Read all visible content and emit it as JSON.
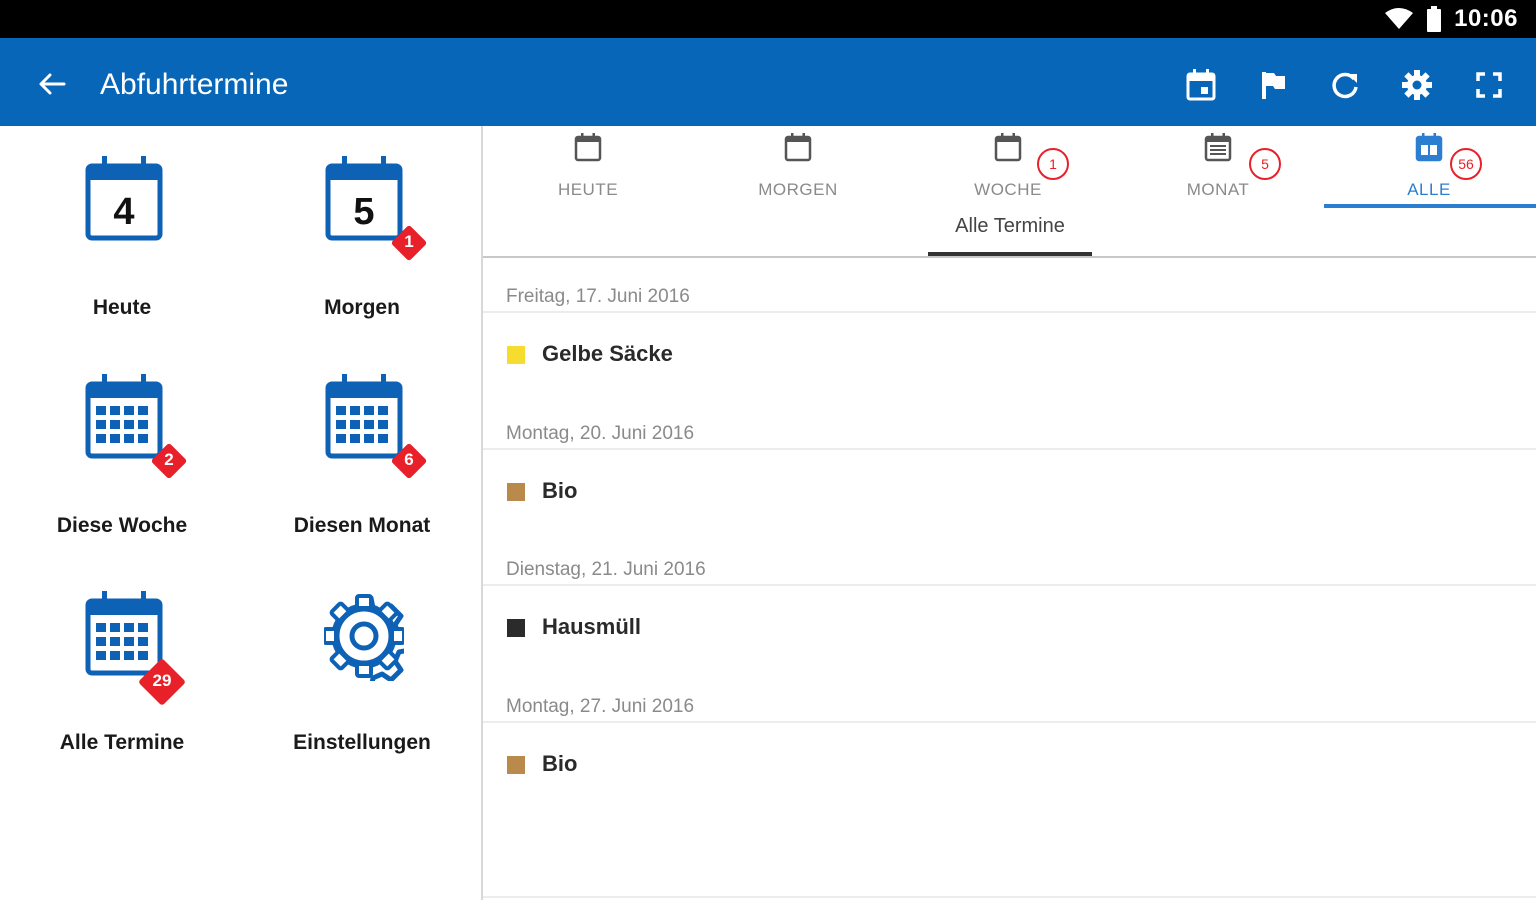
{
  "status_bar": {
    "time": "10:06"
  },
  "app_bar": {
    "title": "Abfuhrtermine",
    "actions": [
      "calendar-today-icon",
      "flag-icon",
      "refresh-icon",
      "settings-icon",
      "fullscreen-icon"
    ]
  },
  "tiles": [
    {
      "label": "Heute",
      "day": "4"
    },
    {
      "label": "Morgen",
      "day": "5",
      "badge": "1"
    },
    {
      "label": "Diese Woche",
      "badge": "2"
    },
    {
      "label": "Diesen Monat",
      "badge": "6"
    },
    {
      "label": "Alle Termine",
      "badge": "29"
    },
    {
      "label": "Einstellungen"
    }
  ],
  "tabs": [
    {
      "label": "HEUTE"
    },
    {
      "label": "MORGEN"
    },
    {
      "label": "WOCHE",
      "count": "1"
    },
    {
      "label": "MONAT",
      "count": "5"
    },
    {
      "label": "ALLE",
      "count": "56",
      "active": true
    }
  ],
  "subtab": "Alle Termine",
  "groups": [
    {
      "date": "Freitag, 17. Juni 2016",
      "item": "Gelbe Säcke",
      "color": "#f5dc2e"
    },
    {
      "date": "Montag, 20. Juni 2016",
      "item": "Bio",
      "color": "#b98a4c"
    },
    {
      "date": "Dienstag, 21. Juni 2016",
      "item": "Hausmüll",
      "color": "#2b2b2b"
    },
    {
      "date": "Montag, 27. Juni 2016",
      "item": "Bio",
      "color": "#b98a4c"
    }
  ],
  "colors": {
    "primary": "#0866b8",
    "accent": "#2c7fd0",
    "badge": "#e8202a"
  }
}
